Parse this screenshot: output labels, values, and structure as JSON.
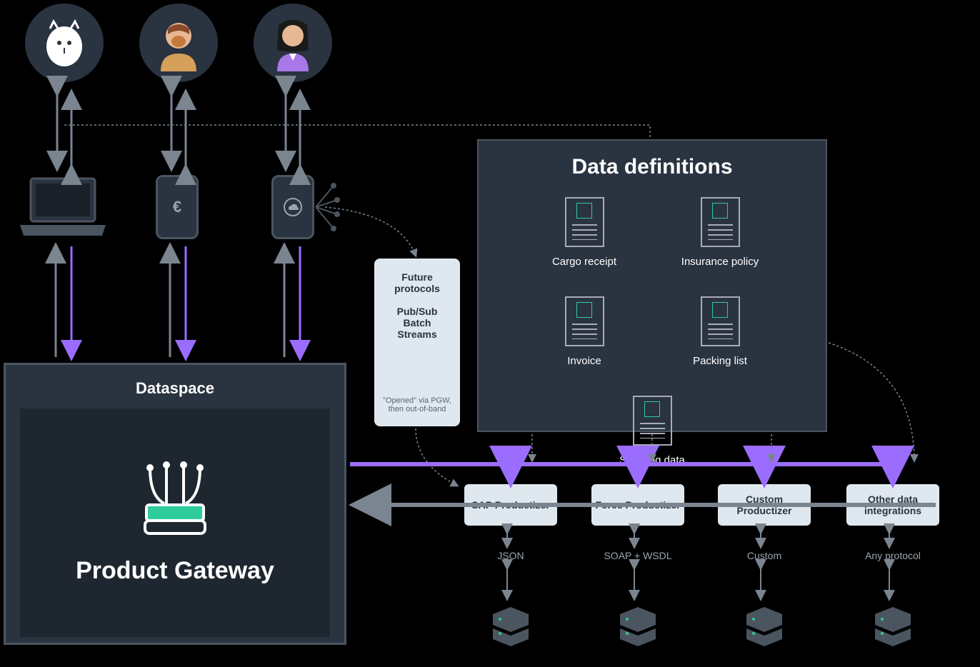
{
  "avatars": [
    "cat",
    "man",
    "woman"
  ],
  "devices": [
    "laptop",
    "phone-euro",
    "phone-cloud"
  ],
  "dataspace": {
    "title": "Dataspace",
    "gateway_title": "Product Gateway"
  },
  "future_protocols": {
    "heading": "Future protocols",
    "lines": [
      "Pub/Sub",
      "Batch",
      "Streams"
    ],
    "note": "\"Opened\" via PGW, then out-of-band"
  },
  "data_definitions": {
    "title": "Data definitions",
    "items": [
      "Cargo receipt",
      "Insurance policy",
      "Invoice",
      "Packing list",
      "Shipping data"
    ]
  },
  "productizers": [
    {
      "label": "SAP Productizer",
      "protocol": "JSON"
    },
    {
      "label": "Force Productizer",
      "protocol": "SOAP + WSDL"
    },
    {
      "label": "Custom Productizer",
      "protocol": "Custom"
    },
    {
      "label": "Other data integrations",
      "protocol": "Any protocol"
    }
  ]
}
